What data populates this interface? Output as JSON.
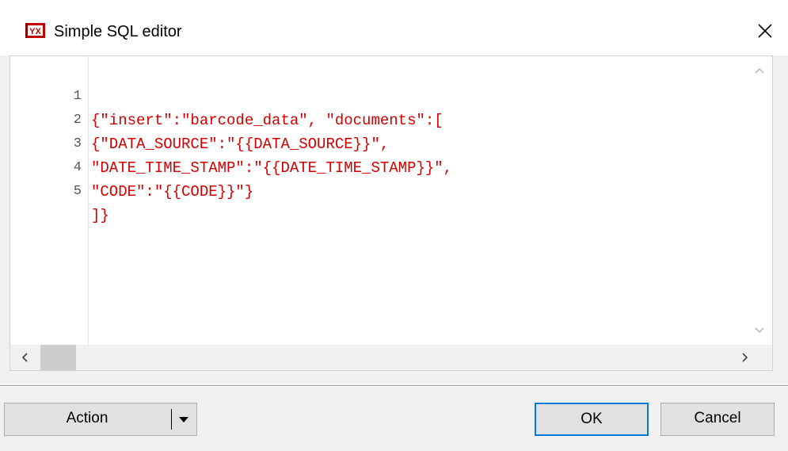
{
  "window": {
    "title": "Simple SQL editor",
    "icon": "app-logo-icon",
    "close_icon": "close-icon"
  },
  "editor": {
    "lines": [
      {
        "number": "1",
        "text": "{\"insert\":\"barcode_data\", \"documents\":["
      },
      {
        "number": "2",
        "text": "{\"DATA_SOURCE\":\"{{DATA_SOURCE}}\","
      },
      {
        "number": "3",
        "text": "\"DATE_TIME_STAMP\":\"{{DATE_TIME_STAMP}}\","
      },
      {
        "number": "4",
        "text": "\"CODE\":\"{{CODE}}\"}"
      },
      {
        "number": "5",
        "text": "]}"
      }
    ],
    "text_color": "#d40000"
  },
  "scrollbars": {
    "vertical_up_icon": "chevron-up-icon",
    "vertical_down_icon": "chevron-down-icon",
    "horizontal_left_icon": "chevron-left-icon",
    "horizontal_right_icon": "chevron-right-icon"
  },
  "buttons": {
    "action_label": "Action",
    "action_dropdown_icon": "dropdown-arrow-icon",
    "ok_label": "OK",
    "cancel_label": "Cancel"
  },
  "colors": {
    "focus_border": "#0078d7",
    "button_face": "#e1e1e1"
  }
}
